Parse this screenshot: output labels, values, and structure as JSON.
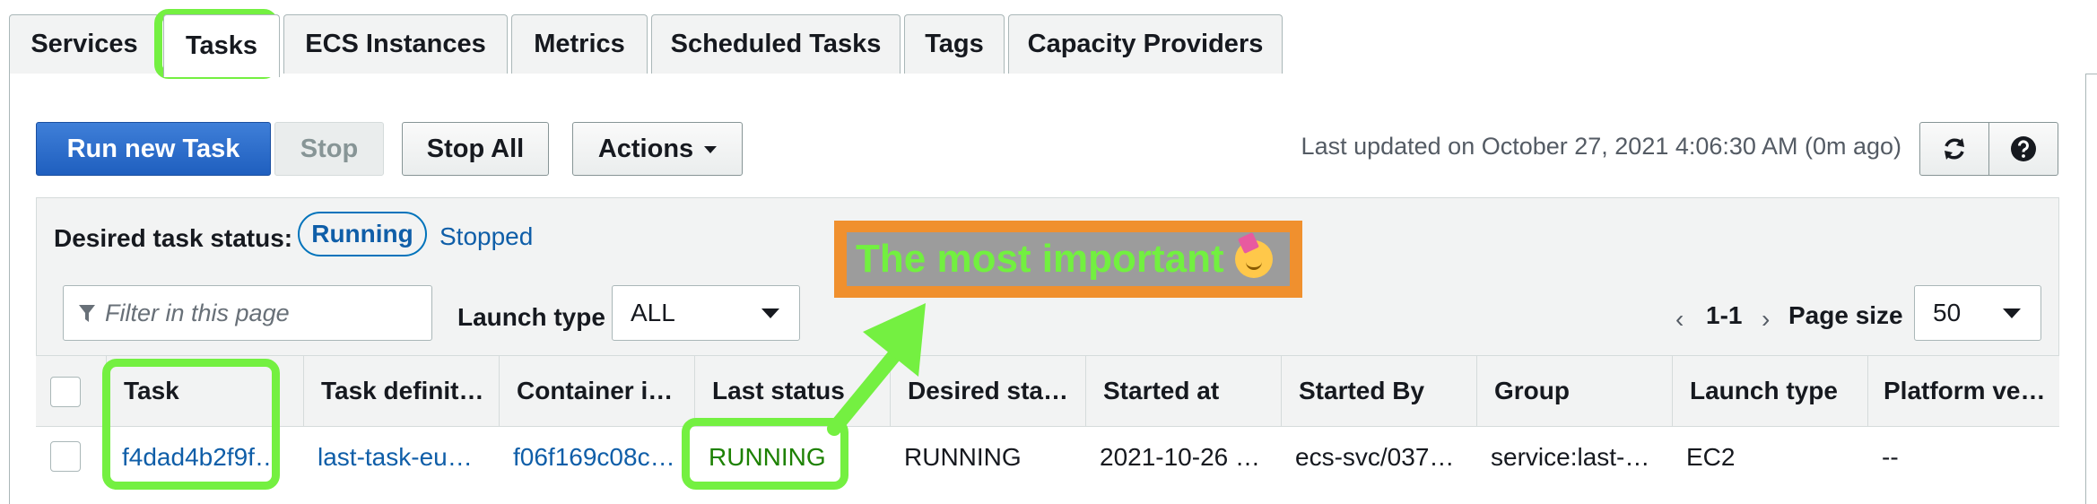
{
  "tabs": [
    {
      "label": "Services"
    },
    {
      "label": "Tasks"
    },
    {
      "label": "ECS Instances"
    },
    {
      "label": "Metrics"
    },
    {
      "label": "Scheduled Tasks"
    },
    {
      "label": "Tags"
    },
    {
      "label": "Capacity Providers"
    }
  ],
  "active_tab": "Tasks",
  "toolbar": {
    "run_label": "Run new Task",
    "stop_label": "Stop",
    "stop_all_label": "Stop All",
    "actions_label": "Actions",
    "last_updated": "Last updated on October 27, 2021 4:06:30 AM (0m ago)",
    "refresh_icon": "refresh-icon",
    "help_icon": "help-icon"
  },
  "filters": {
    "desired_label": "Desired task status:",
    "running_label": "Running",
    "stopped_label": "Stopped",
    "filter_placeholder": "Filter in this page",
    "launch_label": "Launch type",
    "launch_value": "ALL",
    "pager_range": "1-1",
    "page_size_label": "Page size",
    "page_size_value": "50"
  },
  "table": {
    "columns": [
      "Task",
      "Task definit…",
      "Container i…",
      "Last status",
      "Desired sta…",
      "Started at",
      "Started By",
      "Group",
      "Launch type",
      "Platform ve…"
    ],
    "rows": [
      [
        "f4dad4b2f9f…",
        "last-task-eu…",
        "f06f169c08c…",
        "RUNNING",
        "RUNNING",
        "2021-10-26 …",
        "ecs-svc/037…",
        "service:last-…",
        "EC2",
        "--"
      ]
    ]
  },
  "annotation": {
    "callout_text": "The most important",
    "highlight_color": "#74f041",
    "callout_bg": "#f0902e"
  },
  "colors": {
    "primary": "#1f5fbf",
    "link": "#0f5ea8",
    "running_green": "#1d8102"
  }
}
